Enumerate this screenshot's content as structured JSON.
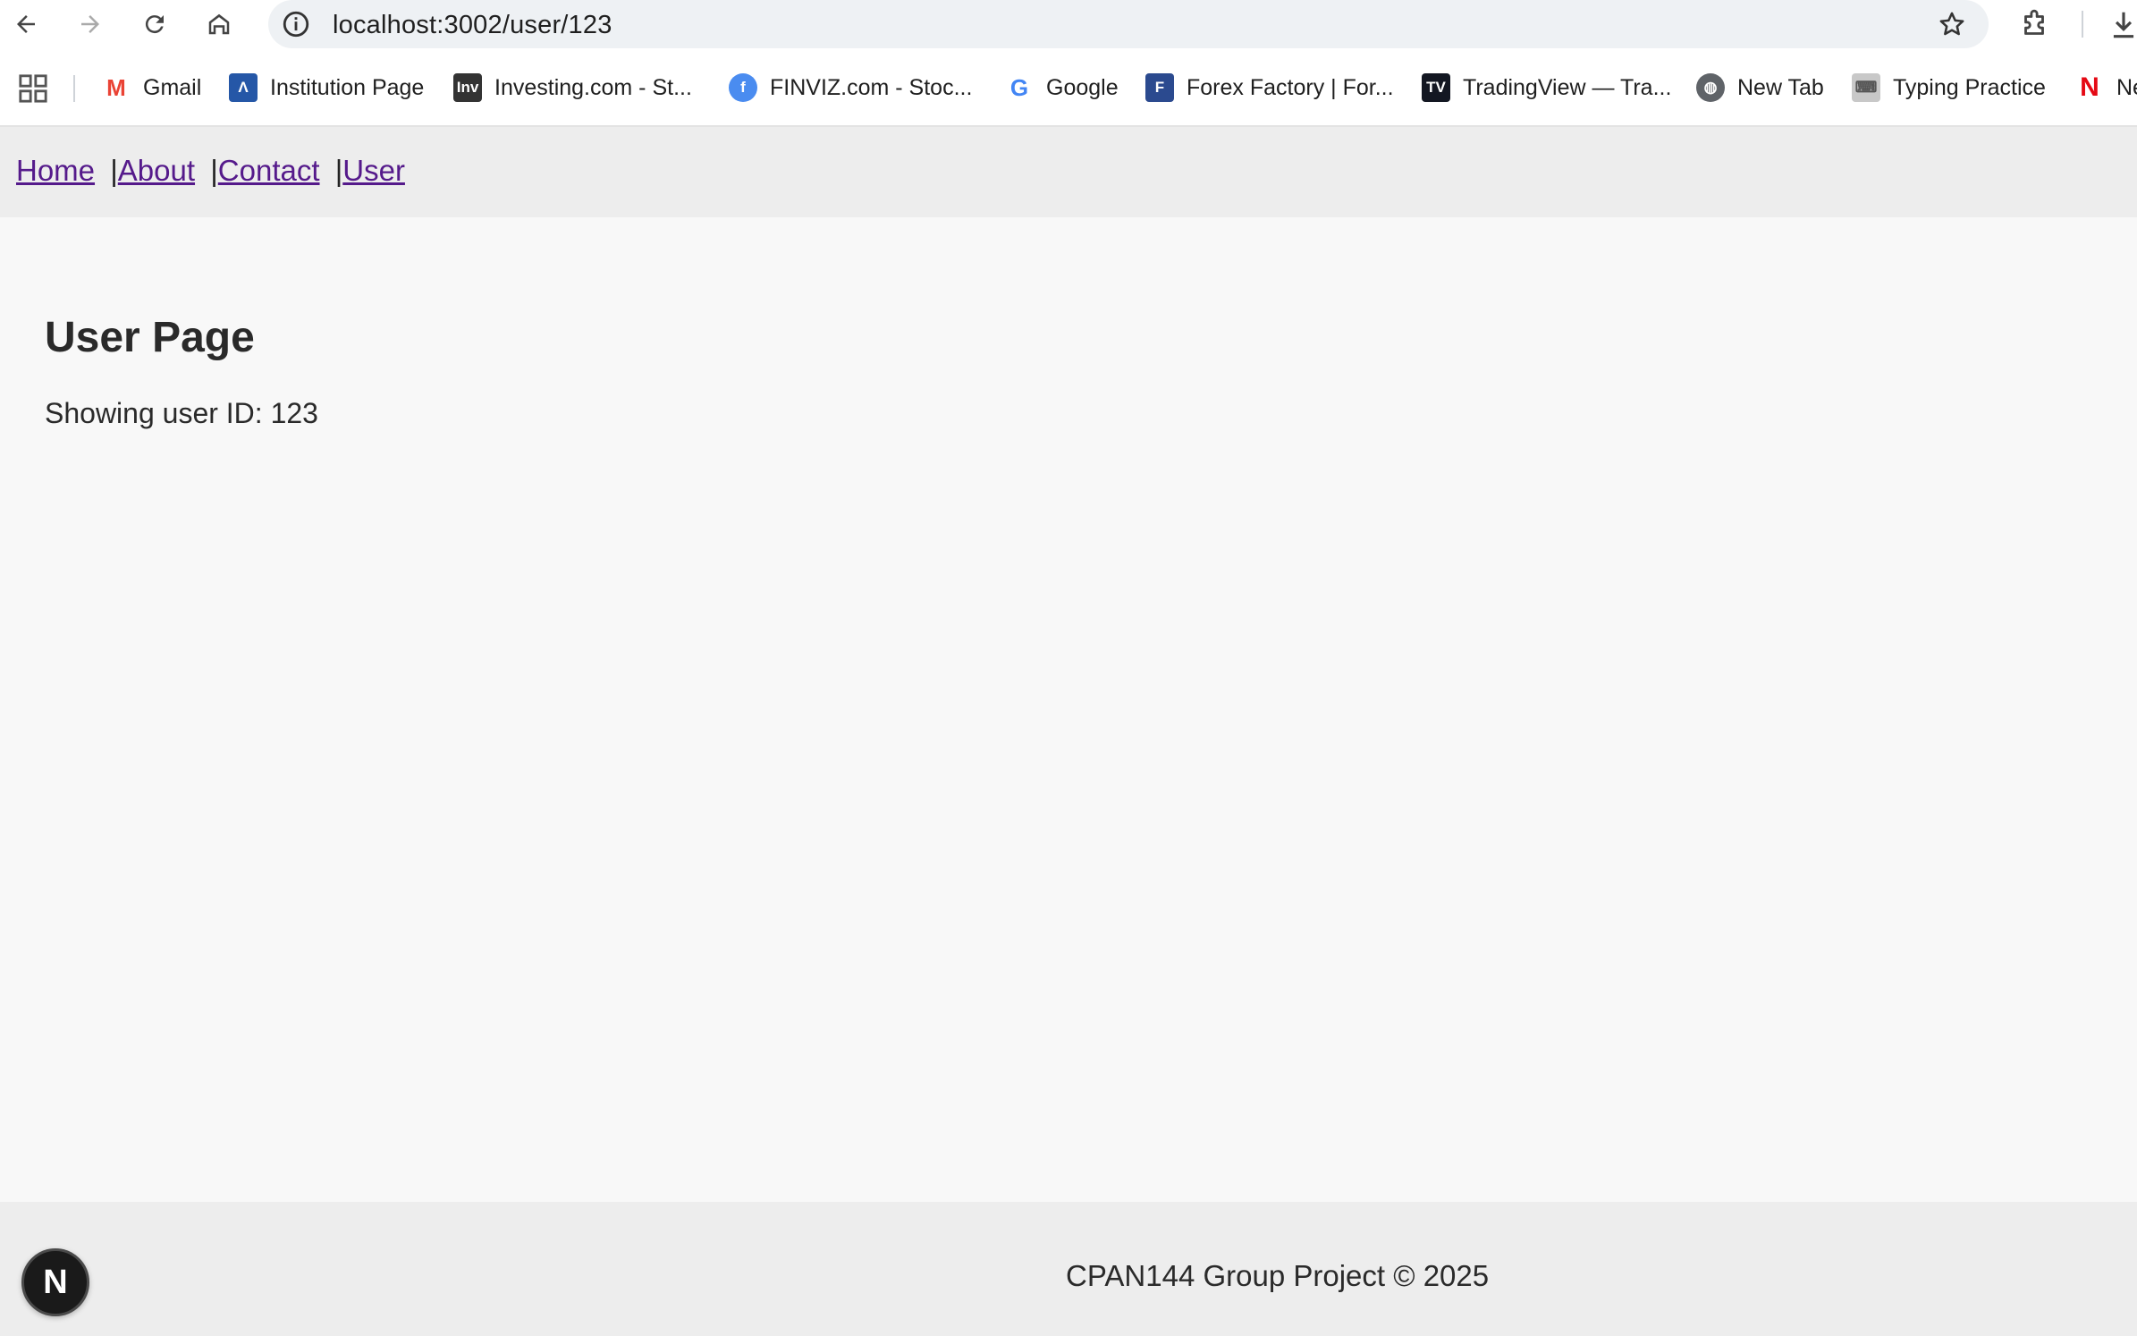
{
  "browser": {
    "url": "localhost:3002/user/123",
    "bookmarks": [
      {
        "label": "Gmail",
        "icon": "gmail-icon",
        "color": "#ea4335"
      },
      {
        "label": "Institution Page",
        "icon": "institution-icon",
        "color": "#2557a7"
      },
      {
        "label": "Investing.com - St...",
        "icon": "investing-icon",
        "color": "#333333"
      },
      {
        "label": "FINVIZ.com - Stoc...",
        "icon": "finviz-icon",
        "color": "#4a8cf0"
      },
      {
        "label": "Google",
        "icon": "google-icon",
        "color": "#4285f4"
      },
      {
        "label": "Forex Factory | For...",
        "icon": "forexfactory-icon",
        "color": "#2b4a8f"
      },
      {
        "label": "TradingView — Tra...",
        "icon": "tradingview-icon",
        "color": "#131722"
      },
      {
        "label": "New Tab",
        "icon": "globe-icon",
        "color": "#5f6368"
      },
      {
        "label": "Typing Practice",
        "icon": "typing-icon",
        "color": "#9aa0a6"
      },
      {
        "label": "Ne",
        "icon": "netflix-icon",
        "color": "#e50914"
      }
    ]
  },
  "site_nav": {
    "links": [
      "Home",
      "About",
      "Contact",
      "User"
    ],
    "separator": "|"
  },
  "main": {
    "title": "User Page",
    "user_info": "Showing user ID: 123"
  },
  "footer": {
    "text": "CPAN144 Group Project © 2025"
  },
  "dev_badge": {
    "letter": "N"
  }
}
